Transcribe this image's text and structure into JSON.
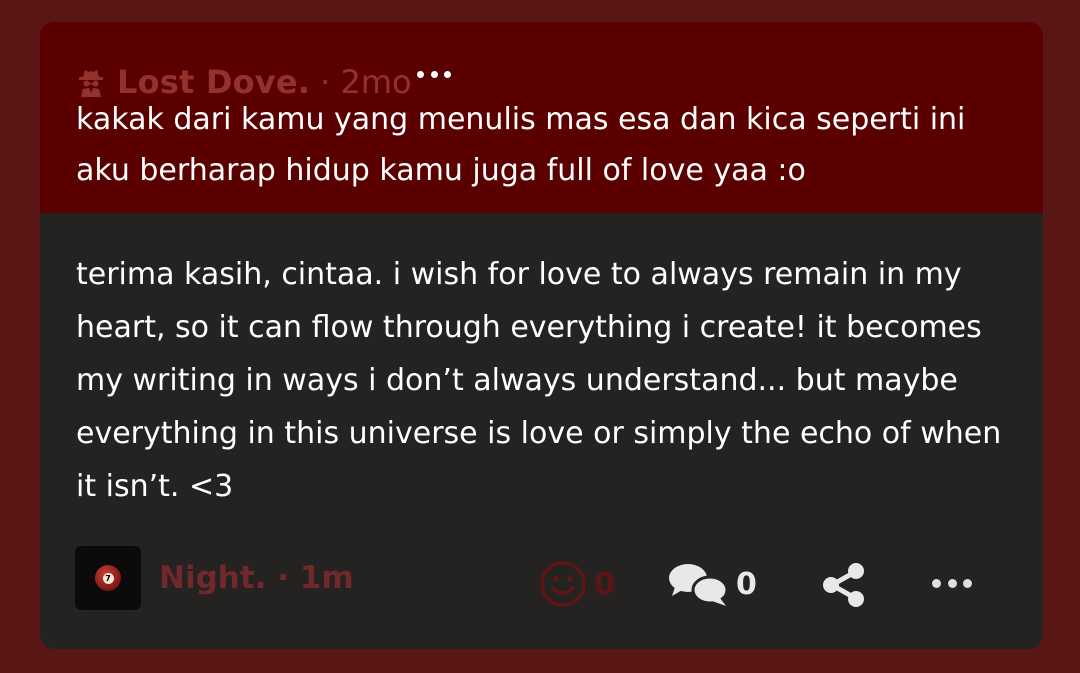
{
  "question": {
    "author": "Lost Dove.",
    "time": "· 2mo",
    "author_icon": "spy-icon",
    "text": "kakak dari kamu yang menulis mas esa dan kica seperti ini aku berharap hidup kamu juga full of love yaa :o"
  },
  "answer": {
    "text": "terima kasih, cintaa. i wish for love to always remain in my heart, so it can flow through everything i create! it becomes my writing in ways i don’t always understand... but maybe everything in this universe is love or simply the echo of when it isn’t. <3",
    "author": "Night.",
    "time": "· 1m",
    "avatar_icon": "billiard-ball-7-icon",
    "avatar_number": "7"
  },
  "actions": {
    "reaction_count": "0",
    "comment_count": "0"
  },
  "colors": {
    "background": "#5a1515",
    "question_bg": "#5b0000",
    "answer_bg": "#252222",
    "muted_red": "#93312d"
  }
}
